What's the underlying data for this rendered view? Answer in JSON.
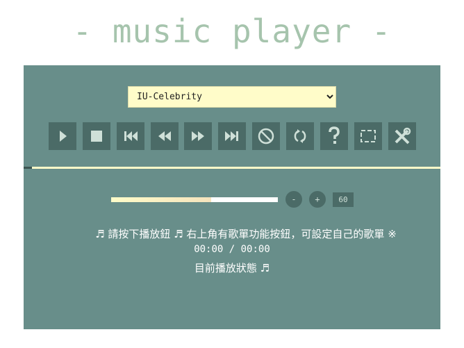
{
  "header": {
    "title": "- music player -"
  },
  "player": {
    "selected_song": "IU-Celebrity",
    "controls": [
      {
        "name": "play-icon"
      },
      {
        "name": "stop-icon"
      },
      {
        "name": "skip-previous-icon"
      },
      {
        "name": "rewind-icon"
      },
      {
        "name": "fast-forward-icon"
      },
      {
        "name": "skip-next-icon"
      },
      {
        "name": "mute-icon"
      },
      {
        "name": "repeat-icon"
      },
      {
        "name": "help-icon"
      },
      {
        "name": "playlist-icon"
      },
      {
        "name": "settings-tools-icon"
      }
    ],
    "progress_fraction": 0.0,
    "volume": {
      "level_fraction": 0.6,
      "minus_label": "-",
      "plus_label": "+",
      "value": "60"
    },
    "status_message": "♬ 請按下播放鈕 ♬ 右上角有歌單功能按鈕，可設定自己的歌單 ※",
    "time_display": "00:00 / 00:00",
    "state_text": "目前播放狀態 ♬"
  },
  "colors": {
    "panel": "#688e8a",
    "button": "#4b6b67",
    "accent": "#fffcc9",
    "title": "#a6c4ad"
  }
}
